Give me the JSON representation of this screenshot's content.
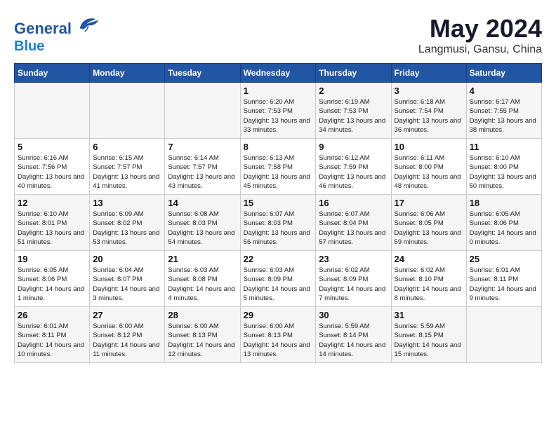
{
  "header": {
    "logo_line1": "General",
    "logo_line2": "Blue",
    "title": "May 2024",
    "subtitle": "Langmusi, Gansu, China"
  },
  "days_of_week": [
    "Sunday",
    "Monday",
    "Tuesday",
    "Wednesday",
    "Thursday",
    "Friday",
    "Saturday"
  ],
  "weeks": [
    [
      {
        "day": "",
        "sunrise": "",
        "sunset": "",
        "daylight": ""
      },
      {
        "day": "",
        "sunrise": "",
        "sunset": "",
        "daylight": ""
      },
      {
        "day": "",
        "sunrise": "",
        "sunset": "",
        "daylight": ""
      },
      {
        "day": "1",
        "sunrise": "6:20 AM",
        "sunset": "7:53 PM",
        "daylight": "13 hours and 33 minutes."
      },
      {
        "day": "2",
        "sunrise": "6:19 AM",
        "sunset": "7:53 PM",
        "daylight": "13 hours and 34 minutes."
      },
      {
        "day": "3",
        "sunrise": "6:18 AM",
        "sunset": "7:54 PM",
        "daylight": "13 hours and 36 minutes."
      },
      {
        "day": "4",
        "sunrise": "6:17 AM",
        "sunset": "7:55 PM",
        "daylight": "13 hours and 38 minutes."
      }
    ],
    [
      {
        "day": "5",
        "sunrise": "6:16 AM",
        "sunset": "7:56 PM",
        "daylight": "13 hours and 40 minutes."
      },
      {
        "day": "6",
        "sunrise": "6:15 AM",
        "sunset": "7:57 PM",
        "daylight": "13 hours and 41 minutes."
      },
      {
        "day": "7",
        "sunrise": "6:14 AM",
        "sunset": "7:57 PM",
        "daylight": "13 hours and 43 minutes."
      },
      {
        "day": "8",
        "sunrise": "6:13 AM",
        "sunset": "7:58 PM",
        "daylight": "13 hours and 45 minutes."
      },
      {
        "day": "9",
        "sunrise": "6:12 AM",
        "sunset": "7:59 PM",
        "daylight": "13 hours and 46 minutes."
      },
      {
        "day": "10",
        "sunrise": "6:11 AM",
        "sunset": "8:00 PM",
        "daylight": "13 hours and 48 minutes."
      },
      {
        "day": "11",
        "sunrise": "6:10 AM",
        "sunset": "8:00 PM",
        "daylight": "13 hours and 50 minutes."
      }
    ],
    [
      {
        "day": "12",
        "sunrise": "6:10 AM",
        "sunset": "8:01 PM",
        "daylight": "13 hours and 51 minutes."
      },
      {
        "day": "13",
        "sunrise": "6:09 AM",
        "sunset": "8:02 PM",
        "daylight": "13 hours and 53 minutes."
      },
      {
        "day": "14",
        "sunrise": "6:08 AM",
        "sunset": "8:03 PM",
        "daylight": "13 hours and 54 minutes."
      },
      {
        "day": "15",
        "sunrise": "6:07 AM",
        "sunset": "8:03 PM",
        "daylight": "13 hours and 56 minutes."
      },
      {
        "day": "16",
        "sunrise": "6:07 AM",
        "sunset": "8:04 PM",
        "daylight": "13 hours and 57 minutes."
      },
      {
        "day": "17",
        "sunrise": "6:06 AM",
        "sunset": "8:05 PM",
        "daylight": "13 hours and 59 minutes."
      },
      {
        "day": "18",
        "sunrise": "6:05 AM",
        "sunset": "8:06 PM",
        "daylight": "14 hours and 0 minutes."
      }
    ],
    [
      {
        "day": "19",
        "sunrise": "6:05 AM",
        "sunset": "8:06 PM",
        "daylight": "14 hours and 1 minute."
      },
      {
        "day": "20",
        "sunrise": "6:04 AM",
        "sunset": "8:07 PM",
        "daylight": "14 hours and 3 minutes."
      },
      {
        "day": "21",
        "sunrise": "6:03 AM",
        "sunset": "8:08 PM",
        "daylight": "14 hours and 4 minutes."
      },
      {
        "day": "22",
        "sunrise": "6:03 AM",
        "sunset": "8:09 PM",
        "daylight": "14 hours and 5 minutes."
      },
      {
        "day": "23",
        "sunrise": "6:02 AM",
        "sunset": "8:09 PM",
        "daylight": "14 hours and 7 minutes."
      },
      {
        "day": "24",
        "sunrise": "6:02 AM",
        "sunset": "8:10 PM",
        "daylight": "14 hours and 8 minutes."
      },
      {
        "day": "25",
        "sunrise": "6:01 AM",
        "sunset": "8:11 PM",
        "daylight": "14 hours and 9 minutes."
      }
    ],
    [
      {
        "day": "26",
        "sunrise": "6:01 AM",
        "sunset": "8:11 PM",
        "daylight": "14 hours and 10 minutes."
      },
      {
        "day": "27",
        "sunrise": "6:00 AM",
        "sunset": "8:12 PM",
        "daylight": "14 hours and 11 minutes."
      },
      {
        "day": "28",
        "sunrise": "6:00 AM",
        "sunset": "8:13 PM",
        "daylight": "14 hours and 12 minutes."
      },
      {
        "day": "29",
        "sunrise": "6:00 AM",
        "sunset": "8:13 PM",
        "daylight": "14 hours and 13 minutes."
      },
      {
        "day": "30",
        "sunrise": "5:59 AM",
        "sunset": "8:14 PM",
        "daylight": "14 hours and 14 minutes."
      },
      {
        "day": "31",
        "sunrise": "5:59 AM",
        "sunset": "8:15 PM",
        "daylight": "14 hours and 15 minutes."
      },
      {
        "day": "",
        "sunrise": "",
        "sunset": "",
        "daylight": ""
      }
    ]
  ]
}
